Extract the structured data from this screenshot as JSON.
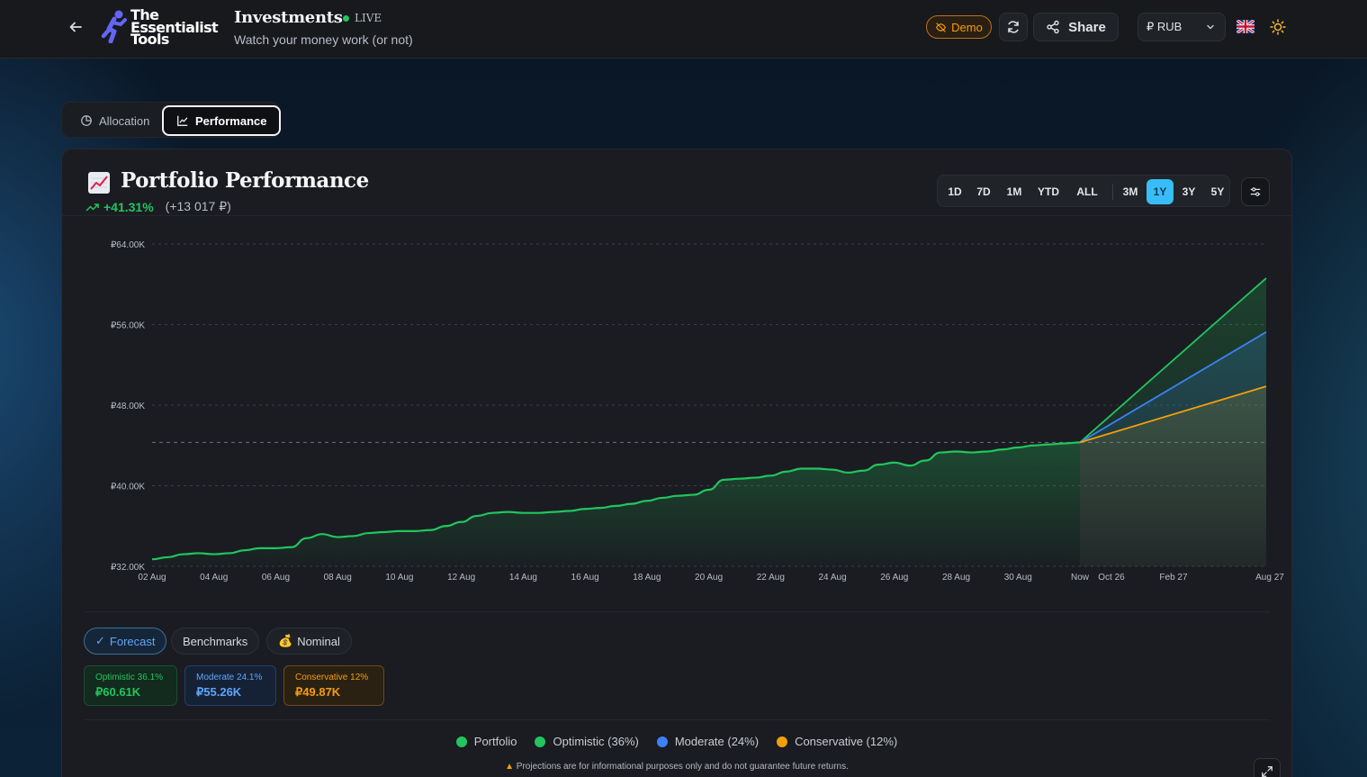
{
  "header": {
    "logo_lines": [
      "The",
      "Essentialist",
      "Tools"
    ],
    "title": "Investments",
    "live_label": "LIVE",
    "subtitle": "Watch your money work (or not)",
    "demo_label": "Demo",
    "share_label": "Share",
    "currency": "₽ RUB",
    "colors": {
      "live": "#22c55e",
      "demo": "#f59e0b",
      "logo_runner": "#6366f1"
    }
  },
  "tabs": [
    {
      "label": "Allocation",
      "icon": "pie-chart-icon",
      "active": false
    },
    {
      "label": "Performance",
      "icon": "line-chart-icon",
      "active": true
    }
  ],
  "panel": {
    "emoji": "📈",
    "title": "Portfolio Performance",
    "change_pct": "+41.31%",
    "change_abs": "(+13 017 ₽)",
    "ranges": [
      "1D",
      "7D",
      "1M",
      "YTD",
      "ALL",
      "3M",
      "1Y",
      "3Y",
      "5Y"
    ],
    "active_range": "1Y"
  },
  "chart_data": {
    "type": "line",
    "title": "",
    "xlabel": "",
    "ylabel": "",
    "ylim": [
      32000,
      64000
    ],
    "y_ticks": [
      "₽64.00K",
      "₽56.00K",
      "₽48.00K",
      "₽40.00K",
      "₽32.00K"
    ],
    "x_ticks_history": [
      "02 Aug",
      "04 Aug",
      "06 Aug",
      "08 Aug",
      "10 Aug",
      "12 Aug",
      "14 Aug",
      "16 Aug",
      "18 Aug",
      "20 Aug",
      "22 Aug",
      "24 Aug",
      "26 Aug",
      "28 Aug",
      "30 Aug",
      "Now"
    ],
    "x_ticks_forecast": [
      "Oct 26",
      "Feb 27",
      "Aug 27"
    ],
    "grid": true,
    "baseline_value": 44300,
    "series": [
      {
        "name": "Portfolio",
        "color": "#22c55e",
        "values": [
          32700,
          32900,
          33200,
          33300,
          33200,
          33300,
          33600,
          33800,
          33800,
          33900,
          34800,
          35200,
          34900,
          35000,
          35300,
          35400,
          35500,
          35500,
          35600,
          36000,
          36400,
          37000,
          37300,
          37400,
          37300,
          37300,
          37400,
          37500,
          37700,
          37800,
          38000,
          38200,
          38500,
          38800,
          39000,
          39100,
          39600,
          40600,
          40700,
          40800,
          41000,
          41400,
          41700,
          41700,
          41600,
          41300,
          41500,
          42100,
          42300,
          42000,
          42500,
          43300,
          43400,
          43300,
          43400,
          43600,
          43800,
          44000,
          44100,
          44200,
          44300
        ]
      },
      {
        "name": "Optimistic (36%)",
        "color": "#22c55e",
        "values": [
          44300,
          60610
        ]
      },
      {
        "name": "Moderate (24%)",
        "color": "#3b82f6",
        "values": [
          44300,
          55260
        ]
      },
      {
        "name": "Conservative (12%)",
        "color": "#f59e0b",
        "values": [
          44300,
          49870
        ]
      }
    ]
  },
  "toggles": [
    {
      "label": "Forecast",
      "prefix": "✓",
      "active": true
    },
    {
      "label": "Benchmarks",
      "prefix": "",
      "active": false
    },
    {
      "label": "Nominal",
      "prefix": "💰",
      "active": false
    }
  ],
  "scenario_cards": [
    {
      "label": "Optimistic 36.1%",
      "value": "₽60.61K"
    },
    {
      "label": "Moderate 24.1%",
      "value": "₽55.26K"
    },
    {
      "label": "Conservative 12%",
      "value": "₽49.87K"
    }
  ],
  "legend": [
    {
      "label": "Portfolio",
      "color": "#22c55e"
    },
    {
      "label": "Optimistic (36%)",
      "color": "#22c55e"
    },
    {
      "label": "Moderate (24%)",
      "color": "#3b82f6"
    },
    {
      "label": "Conservative (12%)",
      "color": "#f59e0b"
    }
  ],
  "disclaimer": "Projections are for informational purposes only and do not guarantee future returns."
}
